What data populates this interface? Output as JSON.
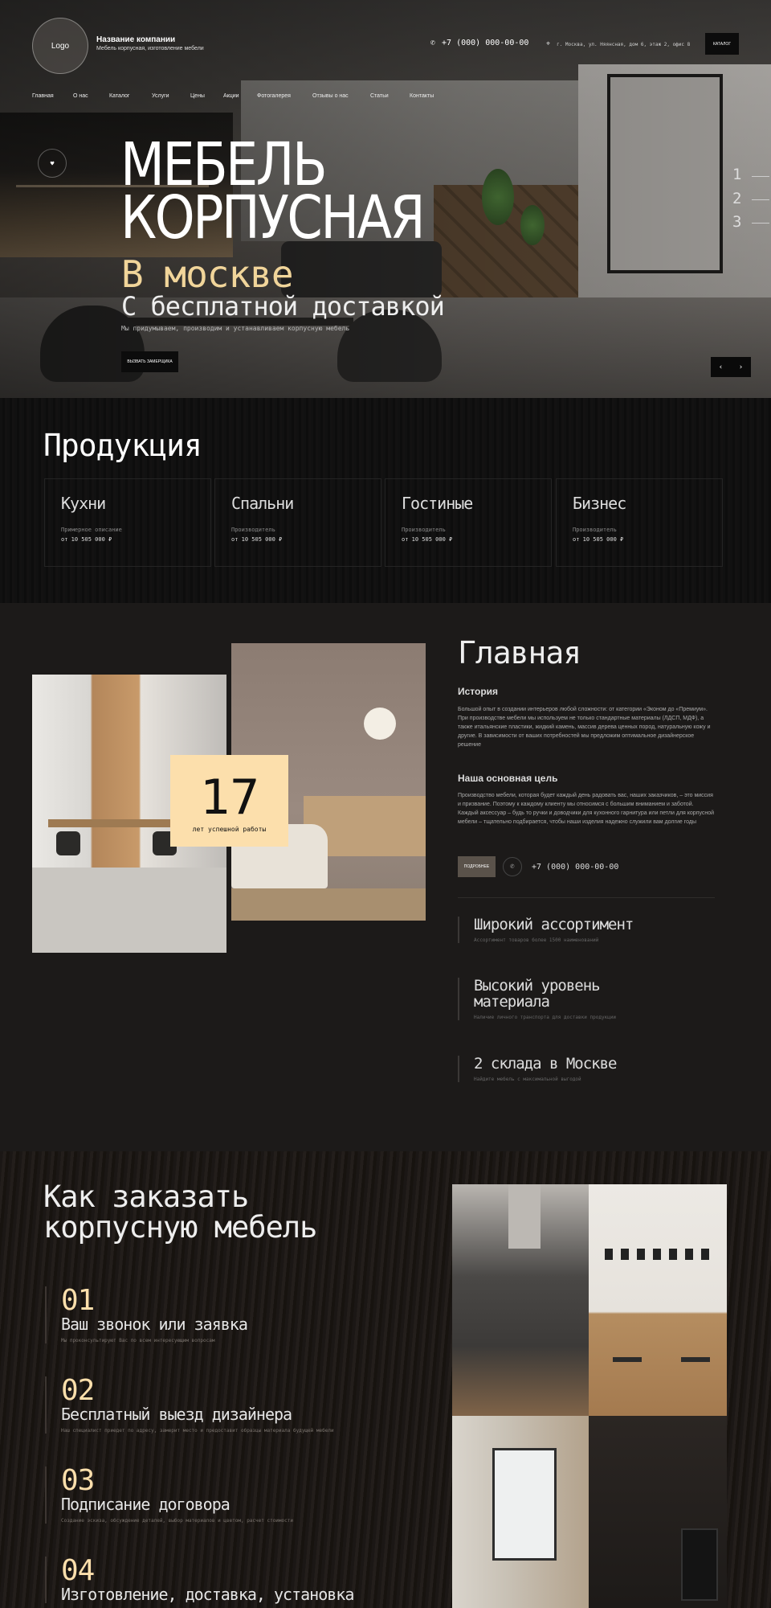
{
  "header": {
    "logo": "Logo",
    "company_name": "Название компании",
    "company_sub": "Мебель корпусная, изготовление мебели",
    "phone": "+7 (000) 000-00-00",
    "address": "г. Москва, ул. Няянсная, дом 6, этаж 2, офис 8",
    "catalog_btn": "КАТАЛОГ"
  },
  "nav": [
    "Главная",
    "О нас",
    "Каталог",
    "Услуги",
    "Цены",
    "Акции",
    "Фотогалерея",
    "Отзывы о нас",
    "Статьи",
    "Контакты"
  ],
  "hero": {
    "fav_icon": "heart-icon",
    "title_line1": "МЕБЕЛЬ",
    "title_line2": "КОРПУСНАЯ",
    "title_accent": "В москве",
    "subtitle": "С бесплатной доставкой",
    "description": "Мы придумываем, производим и устанавливаем корпусную мебель",
    "cta": "ВЫЗВАТЬ ЗАМЕРЩИКА",
    "slides": [
      "1",
      "2",
      "3"
    ],
    "prev": "‹",
    "next": "›"
  },
  "products": {
    "title": "Продукция",
    "items": [
      {
        "name": "Кухни",
        "desc": "Примерное описание",
        "price": "от 10 505 000 ₽"
      },
      {
        "name": "Спальни",
        "desc": "Производитель",
        "price": "от 10 505 000 ₽"
      },
      {
        "name": "Гостиные",
        "desc": "Производитель",
        "price": "от 10 505 000 ₽"
      },
      {
        "name": "Бизнес",
        "desc": "Производитель",
        "price": "от 10 505 000 ₽"
      }
    ]
  },
  "about": {
    "years": "17",
    "years_label": "лет успешной работы",
    "title": "Главная",
    "history_title": "История",
    "history_text": "Большой опыт в создании интерьеров любой сложности: от категории «Эконом до «Премиум». При производстве мебели мы используем не только стандартные материалы (ЛДСП, МДФ), а также итальянские пластики, жидкий камень, массив дерева ценных пород, натуральную кожу и другие. В зависимости от ваших потребностей мы предложим оптимальное дизайнерское решение",
    "goal_title": "Наша основная цель",
    "goal_text": "Производство мебели, которая будет каждый день радовать вас, наших заказчиков, – это миссия и призвание. Поэтому к каждому клиенту мы относимся с большим вниманием и заботой. Каждый аксессуар – будь то ручки и доводчики для кухонного гарнитура или петли для корпусной мебели – тщательно подбирается, чтобы наши изделия надежно служили вам долгие годы",
    "btn": "ПОДРОБНЕЕ",
    "phone": "+7 (000) 000-00-00",
    "features": [
      {
        "title": "Широкий ассортимент",
        "desc": "Ассортимент товаров более 1500 наименований"
      },
      {
        "title": "Высокий уровень материала",
        "desc": "Наличие личного транспорта для доставки продукции"
      },
      {
        "title": "2 склада в Москве",
        "desc": "Найдите мебель с максимальной выгодой"
      }
    ]
  },
  "order": {
    "title_line1": "Как заказать",
    "title_line2": "корпусную мебель",
    "steps": [
      {
        "num": "01",
        "title": "Ваш звонок или заявка",
        "desc": "Мы проконсультируют Вас по всем интересующим вопросам"
      },
      {
        "num": "02",
        "title": "Бесплатный выезд дизайнера",
        "desc": "Наш специалист приедет по адресу, замерит место и предоставит образцы материала будущей мебели"
      },
      {
        "num": "03",
        "title": "Подписание договора",
        "desc": "Создание эскиза, обсуждение деталей, выбор материалов и цветом, расчет стоимости"
      },
      {
        "num": "04",
        "title": "Изготовление, доставка, установка",
        "desc": ""
      }
    ]
  }
}
